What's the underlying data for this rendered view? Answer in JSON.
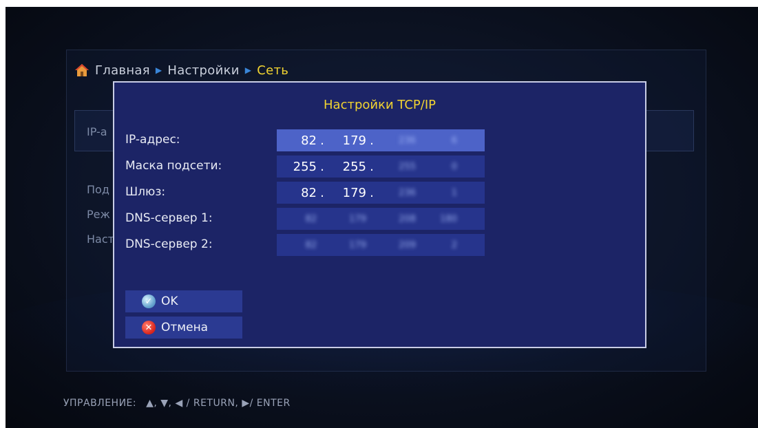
{
  "breadcrumb": {
    "items": [
      "Главная",
      "Настройки",
      "Сеть"
    ]
  },
  "background": {
    "field_label": "IP-а",
    "list_items": [
      "Под",
      "Реж",
      "Наст"
    ]
  },
  "dialog": {
    "title": "Настройки TCP/IP",
    "rows": [
      {
        "label": "IP-адрес:",
        "octets": [
          "82",
          "179",
          "236",
          "6"
        ],
        "selected": true
      },
      {
        "label": "Маска подсети:",
        "octets": [
          "255",
          "255",
          "255",
          "0"
        ],
        "selected": false
      },
      {
        "label": "Шлюз:",
        "octets": [
          "82",
          "179",
          "236",
          "1"
        ],
        "selected": false
      },
      {
        "label": "DNS-сервер 1:",
        "octets": [
          "82",
          "179",
          "208",
          "180"
        ],
        "selected": false
      },
      {
        "label": "DNS-сервер 2:",
        "octets": [
          "82",
          "179",
          "209",
          "2"
        ],
        "selected": false
      }
    ],
    "ok_label": "OK",
    "cancel_label": "Отмена"
  },
  "footer": {
    "label": "УПРАВЛЕНИЕ:",
    "hints": "▲, ▼, ◀ / RETURN, ▶/ ENTER"
  },
  "colors": {
    "dialog_bg": "#1c2466",
    "field_bg": "#26348c",
    "field_selected_bg": "#4d63c8",
    "accent_yellow": "#f2d431",
    "separator_blue": "#3a86d8"
  }
}
